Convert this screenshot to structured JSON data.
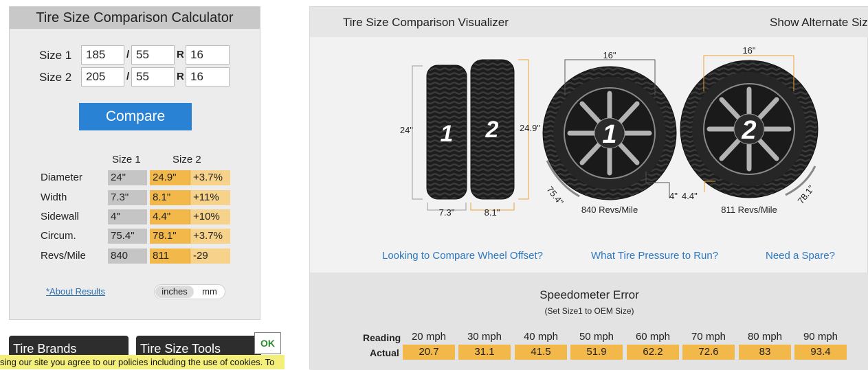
{
  "calculator": {
    "title": "Tire Size Comparison Calculator",
    "size1": {
      "label": "Size 1",
      "width": "185",
      "ratio": "55",
      "rim": "16"
    },
    "size2": {
      "label": "Size 2",
      "width": "205",
      "ratio": "55",
      "rim": "16"
    },
    "slash": "/",
    "r_label": "R",
    "compare_label": "Compare",
    "results": {
      "col1": "Size 1",
      "col2": "Size 2",
      "rows": [
        {
          "label": "Diameter",
          "s1": "24\"",
          "s2": "24.9\"",
          "diff": "+3.7%"
        },
        {
          "label": "Width",
          "s1": "7.3\"",
          "s2": "8.1\"",
          "diff": "+11%"
        },
        {
          "label": "Sidewall",
          "s1": "4\"",
          "s2": "4.4\"",
          "diff": "+10%"
        },
        {
          "label": "Circum.",
          "s1": "75.4\"",
          "s2": "78.1\"",
          "diff": "+3.7%"
        },
        {
          "label": "Revs/Mile",
          "s1": "840",
          "s2": "811",
          "diff": "-29"
        }
      ]
    },
    "about_link": "*About Results",
    "units": {
      "inches": "inches",
      "mm": "mm",
      "selected": "inches"
    }
  },
  "bottom_tabs": {
    "brands": "Tire Brands",
    "tools": "Tire Size Tools"
  },
  "cookie": {
    "text": "sing our site you agree to our policies including the use of cookies. To",
    "ok": "OK"
  },
  "visualizer": {
    "title": "Tire Size Comparison Visualizer",
    "alt_link": "Show Alternate Siz",
    "side_view": {
      "tire1": {
        "number": "1",
        "diameter": "24\"",
        "width": "7.3\""
      },
      "tire2": {
        "number": "2",
        "diameter": "24.9\"",
        "width": "8.1\""
      }
    },
    "wheel1": {
      "number": "1",
      "rim": "16\"",
      "sidewall": "4\"",
      "circumference": "75.4\"",
      "revs": "840 Revs/Mile"
    },
    "wheel2": {
      "number": "2",
      "rim": "16\"",
      "sidewall": "4.4\"",
      "circumference": "78.1\"",
      "revs": "811 Revs/Mile"
    },
    "links": {
      "offset": "Looking to Compare Wheel Offset?",
      "pressure": "What Tire Pressure to Run?",
      "spare": "Need a Spare?"
    }
  },
  "speedometer": {
    "title": "Speedometer Error",
    "subtitle": "(Set Size1 to OEM Size)",
    "reading_label": "Reading",
    "actual_label": "Actual",
    "readings": [
      "20 mph",
      "30 mph",
      "40 mph",
      "50 mph",
      "60 mph",
      "70 mph",
      "80 mph",
      "90 mph"
    ],
    "actuals": [
      "20.7",
      "31.1",
      "41.5",
      "51.9",
      "62.2",
      "72.6",
      "83",
      "93.4"
    ]
  },
  "colors": {
    "accent_blue": "#2a82d4",
    "size2_orange": "#f2b849",
    "size1_gray": "#c5c5c5",
    "dim_line": "#e8a23a"
  }
}
